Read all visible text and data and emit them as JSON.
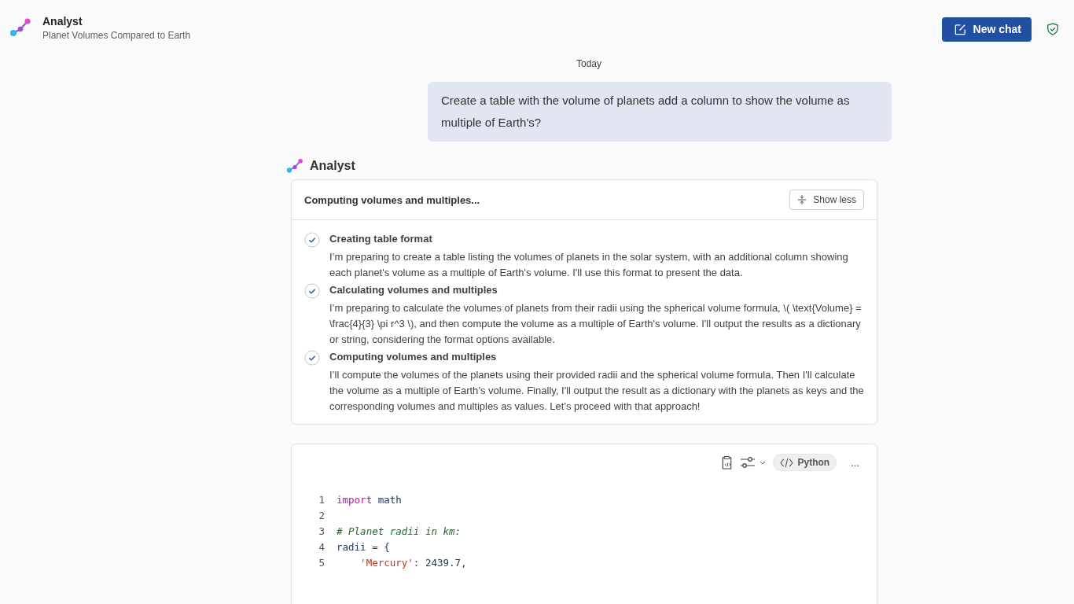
{
  "header": {
    "title": "Analyst",
    "subtitle": "Planet Volumes Compared to Earth",
    "new_chat_button": "New chat"
  },
  "date_divider": "Today",
  "user_message": "Create a table with the volume of planets add a column to show the volume as multiple of Earth's?",
  "assistant": {
    "name": "Analyst",
    "reasoning": {
      "title": "Computing volumes and multiples...",
      "toggle_button": "Show less",
      "expanded": true,
      "steps": [
        {
          "title": "Creating table format",
          "done": true,
          "text": "I’m preparing to create a table listing the volumes of planets in the solar system, with an additional column showing each planet's volume as a multiple of Earth's volume. I'll use this format to present the data."
        },
        {
          "title": "Calculating volumes and multiples",
          "done": true,
          "text": "I’m preparing to calculate the volumes of planets from their radii using the spherical volume formula, \\( \\text{Volume} = \\frac{4}{3} \\pi r^3 \\), and then compute the volume as a multiple of Earth's volume. I'll output the results as a dictionary or string, considering the format options available."
        },
        {
          "title": "Computing volumes and multiples",
          "done": true,
          "text": "I’ll compute the volumes of the planets using their provided radii and the spherical volume formula. Then I'll calculate the volume as a multiple of Earth’s volume. Finally, I'll output the result as a dictionary with the planets as keys and the corresponding volumes and multiples as values. Let's proceed with that approach!"
        }
      ]
    },
    "code": {
      "language": "Python",
      "more": "...",
      "lines": [
        {
          "number": "1",
          "tokens": [
            {
              "kind": "keyword",
              "text": "import"
            },
            {
              "kind": "name",
              "text": " math"
            }
          ]
        },
        {
          "number": "2"
        },
        {
          "number": "3",
          "tokens": [
            {
              "kind": "comment",
              "text": "# Planet radii in km:"
            }
          ]
        },
        {
          "number": "4",
          "tokens": [
            {
              "kind": "name",
              "text": "radii"
            },
            {
              "kind": "plain",
              "text": " = {"
            }
          ]
        },
        {
          "number": "5",
          "tokens": [
            {
              "kind": "string",
              "text": "    'Mercury'"
            },
            {
              "kind": "plain",
              "text": ": 2439.7,"
            }
          ]
        }
      ]
    }
  }
}
